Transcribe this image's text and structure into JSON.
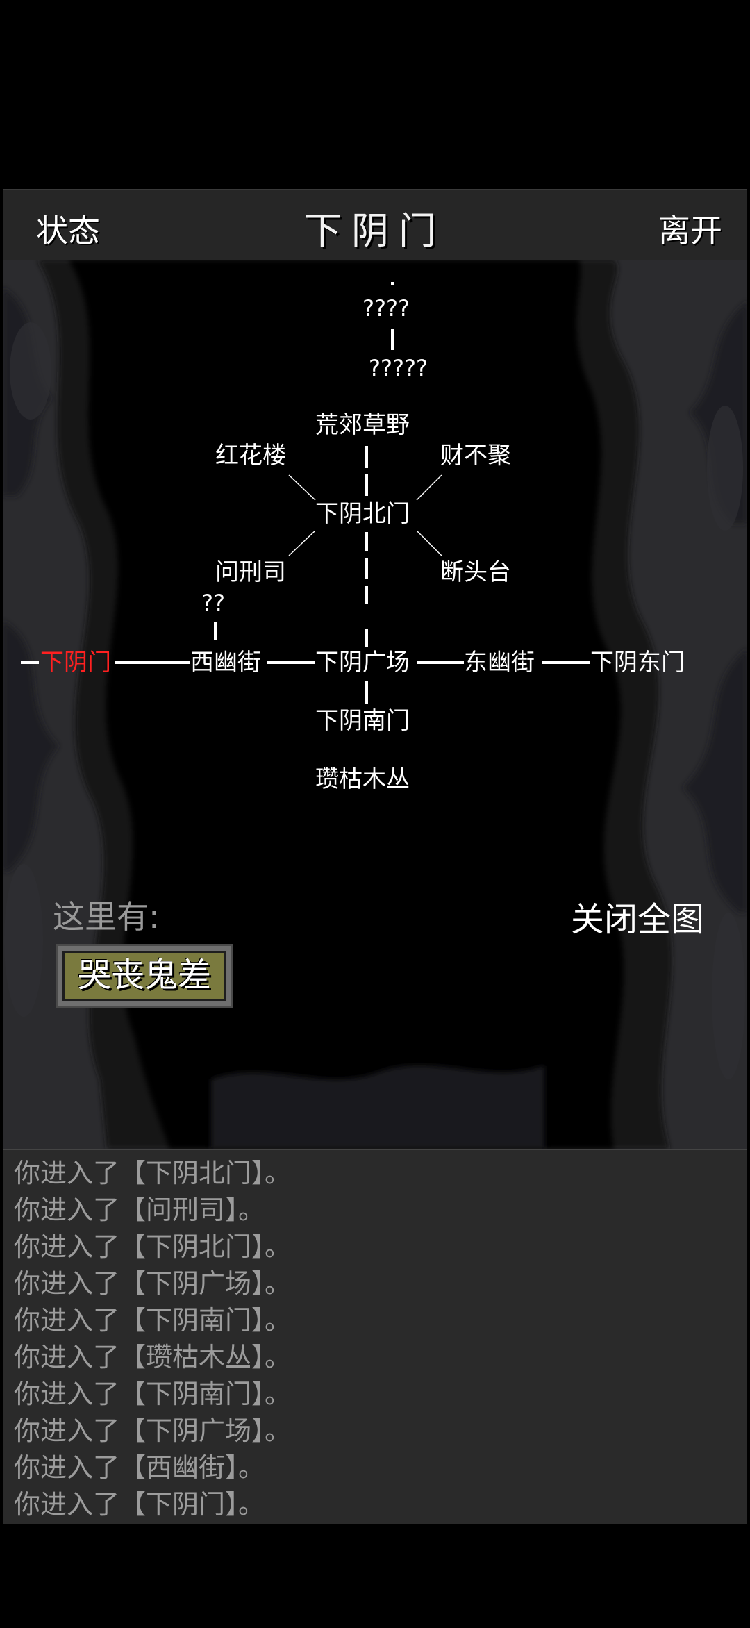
{
  "header": {
    "status_label": "状态",
    "title": "下阴门",
    "leave_label": "离开"
  },
  "map": {
    "unknown_top": "????",
    "unknown_second": "?????",
    "unknown_west": "??",
    "locations": {
      "huangjiao": "荒郊草野",
      "honghualou": "红花楼",
      "caibuju": "财不聚",
      "beimen": "下阴北门",
      "wenxingsi": "问刑司",
      "duantoutai": "断头台",
      "xiayinmen": "下阴门",
      "xiyoujie": "西幽街",
      "guangchang": "下阴广场",
      "dongyoujie": "东幽街",
      "dongmen": "下阴东门",
      "nanmen": "下阴南门",
      "zankumucong": "瓒枯木丛"
    },
    "current_color": "#ff2020"
  },
  "here": {
    "label": "这里有:",
    "npc_name": "哭丧鬼差"
  },
  "close_map_label": "关闭全图",
  "log": {
    "lines": [
      "你进入了【下阴北门】。",
      "你进入了【问刑司】。",
      "你进入了【下阴北门】。",
      "你进入了【下阴广场】。",
      "你进入了【下阴南门】。",
      "你进入了【瓒枯木丛】。",
      "你进入了【下阴南门】。",
      "你进入了【下阴广场】。",
      "你进入了【西幽街】。",
      "你进入了【下阴门】。"
    ]
  }
}
